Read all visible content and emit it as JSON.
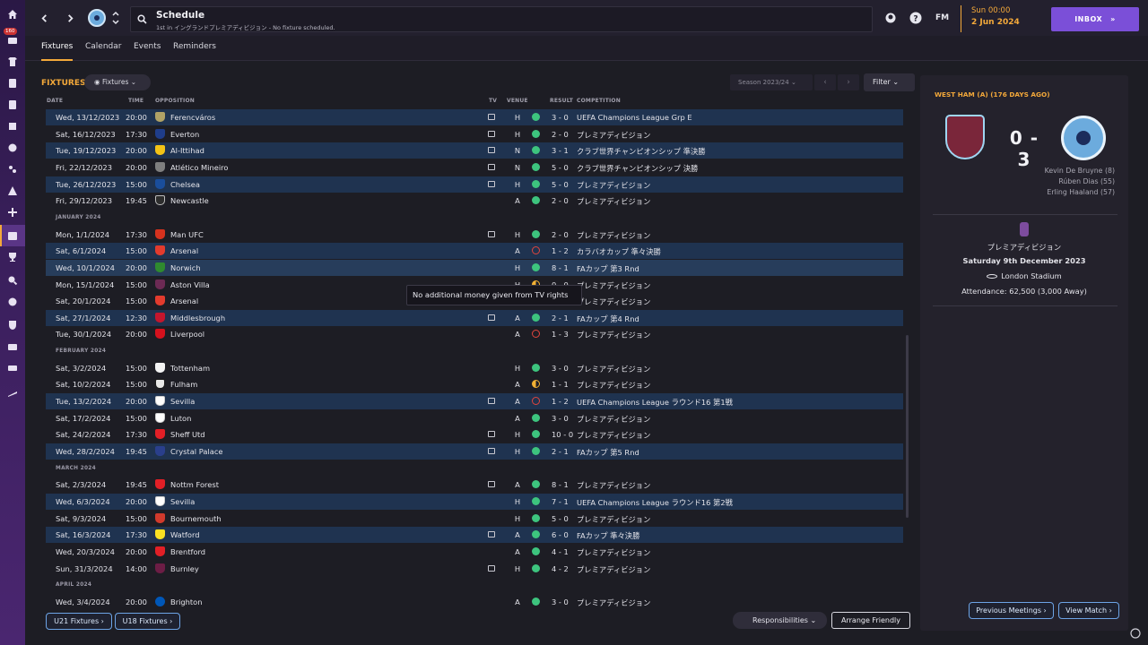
{
  "header": {
    "title": "Schedule",
    "subtitle": "1st in イングランドプレミアディビジョン - No fixture scheduled.",
    "fm_label": "FM",
    "date_day": "Sun 00:00",
    "date_full": "2 Jun 2024",
    "inbox_label": "INBOX",
    "rail_badge": "160"
  },
  "tabs": [
    "Fixtures",
    "Calendar",
    "Events",
    "Reminders"
  ],
  "fixtures_panel": {
    "title": "FIXTURES",
    "view_dropdown": "Fixtures",
    "season": "Season 2023/24",
    "filter_label": "Filter",
    "columns": {
      "date": "DATE",
      "time": "TIME",
      "opposition": "OPPOSITION",
      "tv": "TV",
      "venue": "VENUE",
      "result": "RESULT",
      "competition": "COMPETITION"
    }
  },
  "rows": [
    {
      "date": "Wed, 13/12/2023",
      "time": "20:00",
      "opp": "Ferencváros",
      "tv": true,
      "venue": "H",
      "res": "win",
      "score": "3 - 0",
      "comp": "UEFA Champions League Grp E",
      "crest": "crest-a",
      "style": "hl"
    },
    {
      "date": "Sat, 16/12/2023",
      "time": "17:30",
      "opp": "Everton",
      "tv": true,
      "venue": "H",
      "res": "win",
      "score": "2 - 0",
      "comp": "プレミアディビジョン",
      "crest": "crest-b",
      "style": ""
    },
    {
      "date": "Tue, 19/12/2023",
      "time": "20:00",
      "opp": "Al-Ittihad",
      "tv": true,
      "venue": "N",
      "res": "win",
      "score": "3 - 1",
      "comp": "クラブ世界チャンピオンシップ 準決勝",
      "crest": "crest-c",
      "style": "hl"
    },
    {
      "date": "Fri, 22/12/2023",
      "time": "20:00",
      "opp": "Atlético Mineiro",
      "tv": true,
      "venue": "N",
      "res": "win",
      "score": "5 - 0",
      "comp": "クラブ世界チャンピオンシップ 決勝",
      "crest": "crest-d",
      "style": ""
    },
    {
      "date": "Tue, 26/12/2023",
      "time": "15:00",
      "opp": "Chelsea",
      "tv": true,
      "venue": "H",
      "res": "win",
      "score": "5 - 0",
      "comp": "プレミアディビジョン",
      "crest": "crest-e",
      "style": "hl"
    },
    {
      "date": "Fri, 29/12/2023",
      "time": "19:45",
      "opp": "Newcastle",
      "tv": false,
      "venue": "A",
      "res": "win",
      "score": "2 - 0",
      "comp": "プレミアディビジョン",
      "crest": "crest-f",
      "style": ""
    },
    {
      "section": "JANUARY 2024"
    },
    {
      "date": "Mon, 1/1/2024",
      "time": "17:30",
      "opp": "Man UFC",
      "tv": true,
      "venue": "H",
      "res": "win",
      "score": "2 - 0",
      "comp": "プレミアディビジョン",
      "crest": "crest-g",
      "style": ""
    },
    {
      "date": "Sat, 6/1/2024",
      "time": "15:00",
      "opp": "Arsenal",
      "tv": false,
      "venue": "A",
      "res": "loss",
      "score": "1 - 2",
      "comp": "カラバオカップ 準々決勝",
      "crest": "crest-h",
      "style": "hl"
    },
    {
      "date": "Wed, 10/1/2024",
      "time": "20:00",
      "opp": "Norwich",
      "tv": false,
      "venue": "H",
      "res": "win",
      "score": "8 - 1",
      "comp": "FAカップ 第3 Rnd",
      "crest": "crest-i",
      "style": "sel"
    },
    {
      "date": "Mon, 15/1/2024",
      "time": "15:00",
      "opp": "Aston Villa",
      "tv": false,
      "venue": "H",
      "res": "draw",
      "score": "0 - 0",
      "comp": "プレミアディビジョン",
      "crest": "crest-j",
      "style": ""
    },
    {
      "date": "Sat, 20/1/2024",
      "time": "15:00",
      "opp": "Arsenal",
      "tv": false,
      "venue": "A",
      "res": "win",
      "score": "2 - 1",
      "comp": "プレミアディビジョン",
      "crest": "crest-h",
      "style": ""
    },
    {
      "date": "Sat, 27/1/2024",
      "time": "12:30",
      "opp": "Middlesbrough",
      "tv": true,
      "venue": "A",
      "res": "win",
      "score": "2 - 1",
      "comp": "FAカップ 第4 Rnd",
      "crest": "crest-k",
      "style": "hl"
    },
    {
      "date": "Tue, 30/1/2024",
      "time": "20:00",
      "opp": "Liverpool",
      "tv": false,
      "venue": "A",
      "res": "loss",
      "score": "1 - 3",
      "comp": "プレミアディビジョン",
      "crest": "crest-l",
      "style": ""
    },
    {
      "section": "FEBRUARY 2024"
    },
    {
      "date": "Sat, 3/2/2024",
      "time": "15:00",
      "opp": "Tottenham",
      "tv": false,
      "venue": "H",
      "res": "win",
      "score": "3 - 0",
      "comp": "プレミアディビジョン",
      "crest": "crest-m",
      "style": ""
    },
    {
      "date": "Sat, 10/2/2024",
      "time": "15:00",
      "opp": "Fulham",
      "tv": false,
      "venue": "A",
      "res": "draw",
      "score": "1 - 1",
      "comp": "プレミアディビジョン",
      "crest": "crest-n",
      "style": ""
    },
    {
      "date": "Tue, 13/2/2024",
      "time": "20:00",
      "opp": "Sevilla",
      "tv": true,
      "venue": "A",
      "res": "loss",
      "score": "1 - 2",
      "comp": "UEFA Champions League ラウンド16 第1戦",
      "crest": "crest-o",
      "style": "hl"
    },
    {
      "date": "Sat, 17/2/2024",
      "time": "15:00",
      "opp": "Luton",
      "tv": false,
      "venue": "A",
      "res": "win",
      "score": "3 - 0",
      "comp": "プレミアディビジョン",
      "crest": "crest-o",
      "style": ""
    },
    {
      "date": "Sat, 24/2/2024",
      "time": "17:30",
      "opp": "Sheff Utd",
      "tv": true,
      "venue": "H",
      "res": "win",
      "score": "10 - 0",
      "comp": "プレミアディビジョン",
      "crest": "crest-q",
      "style": ""
    },
    {
      "date": "Wed, 28/2/2024",
      "time": "19:45",
      "opp": "Crystal Palace",
      "tv": true,
      "venue": "H",
      "res": "win",
      "score": "2 - 1",
      "comp": "FAカップ 第5 Rnd",
      "crest": "crest-p",
      "style": "hl"
    },
    {
      "section": "MARCH 2024"
    },
    {
      "date": "Sat, 2/3/2024",
      "time": "19:45",
      "opp": "Nottm Forest",
      "tv": true,
      "venue": "A",
      "res": "win",
      "score": "8 - 1",
      "comp": "プレミアディビジョン",
      "crest": "crest-q",
      "style": ""
    },
    {
      "date": "Wed, 6/3/2024",
      "time": "20:00",
      "opp": "Sevilla",
      "tv": false,
      "venue": "H",
      "res": "win",
      "score": "7 - 1",
      "comp": "UEFA Champions League ラウンド16 第2戦",
      "crest": "crest-o",
      "style": "hl"
    },
    {
      "date": "Sat, 9/3/2024",
      "time": "15:00",
      "opp": "Bournemouth",
      "tv": false,
      "venue": "H",
      "res": "win",
      "score": "5 - 0",
      "comp": "プレミアディビジョン",
      "crest": "crest-r",
      "style": ""
    },
    {
      "date": "Sat, 16/3/2024",
      "time": "17:30",
      "opp": "Watford",
      "tv": true,
      "venue": "A",
      "res": "win",
      "score": "6 - 0",
      "comp": "FAカップ 準々決勝",
      "crest": "crest-s",
      "style": "hl"
    },
    {
      "date": "Wed, 20/3/2024",
      "time": "20:00",
      "opp": "Brentford",
      "tv": false,
      "venue": "A",
      "res": "win",
      "score": "4 - 1",
      "comp": "プレミアディビジョン",
      "crest": "crest-q",
      "style": ""
    },
    {
      "date": "Sun, 31/3/2024",
      "time": "14:00",
      "opp": "Burnley",
      "tv": true,
      "venue": "H",
      "res": "win",
      "score": "4 - 2",
      "comp": "プレミアディビジョン",
      "crest": "crest-t",
      "style": ""
    },
    {
      "section": "APRIL 2024"
    },
    {
      "date": "Wed, 3/4/2024",
      "time": "20:00",
      "opp": "Brighton",
      "tv": false,
      "venue": "A",
      "res": "win",
      "score": "3 - 0",
      "comp": "プレミアディビジョン",
      "crest": "crest-u",
      "style": ""
    }
  ],
  "tooltip": "No additional money given from TV rights",
  "footer": {
    "u21": "U21 Fixtures",
    "u18": "U18 Fixtures",
    "responsibilities": "Responsibilities",
    "arrange_friendly": "Arrange Friendly"
  },
  "match_panel": {
    "title": "WEST HAM (A) (176 DAYS AGO)",
    "score": "0 - 3",
    "scorers": [
      "Kevin De Bruyne (8)",
      "Rúben Dias (55)",
      "Erling Haaland (57)"
    ],
    "competition": "プレミアディビジョン",
    "date": "Saturday 9th December 2023",
    "stadium": "London Stadium",
    "attendance": "Attendance: 62,500 (3,000 Away)",
    "previous_meetings": "Previous Meetings",
    "view_match": "View Match"
  },
  "colors": {
    "win": "#3dc47e",
    "loss": "#e0453d",
    "draw": "#f2b134",
    "accent": "#f4a93a",
    "inbox": "#7b4fd8"
  }
}
